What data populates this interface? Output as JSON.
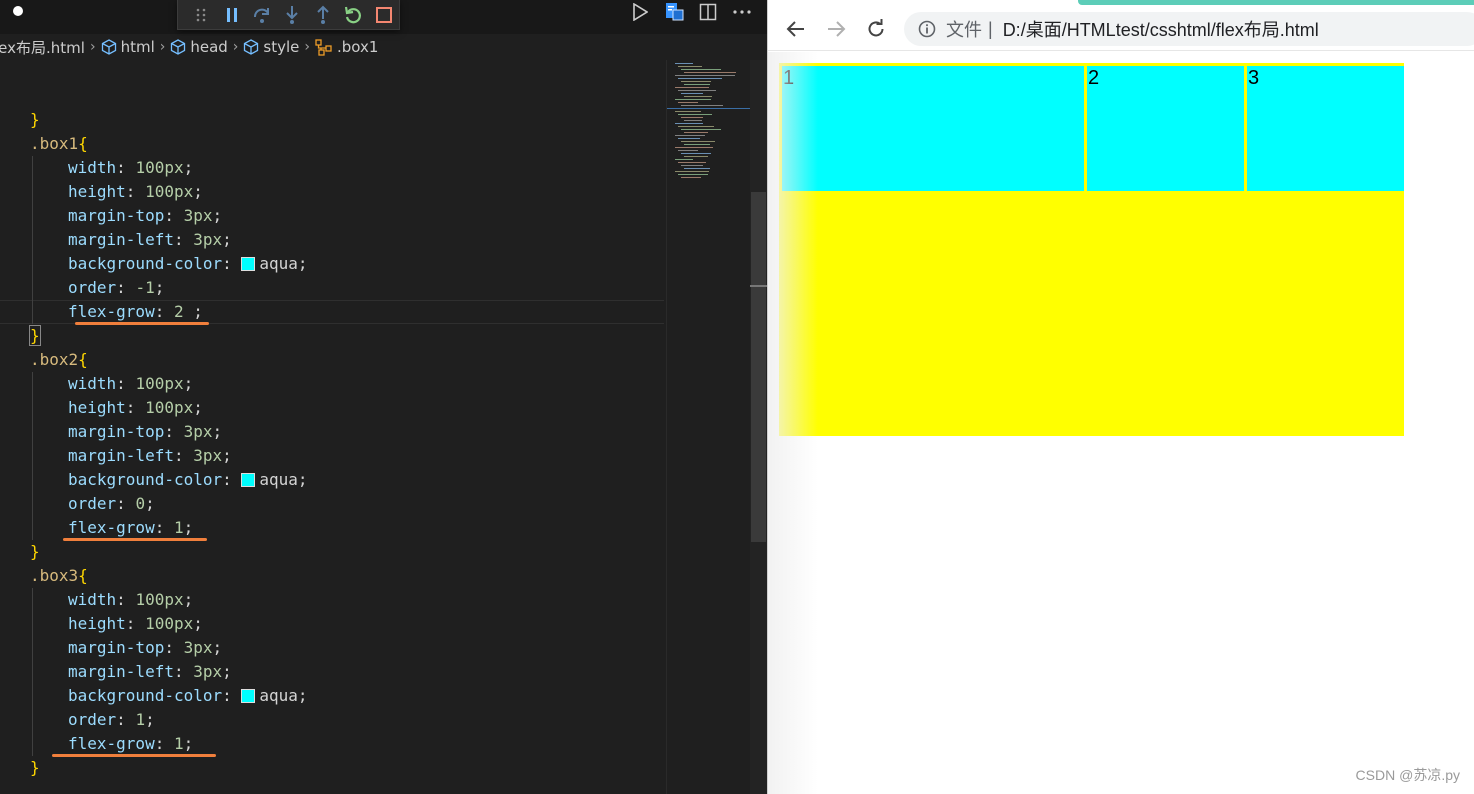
{
  "editor": {
    "breadcrumb": [
      "lex布局.html",
      "html",
      "head",
      "style",
      ".box1"
    ],
    "rules": [
      {
        "selector": ".box1",
        "decls": [
          {
            "prop": "width",
            "value": "100px"
          },
          {
            "prop": "height",
            "value": "100px"
          },
          {
            "prop": "margin-top",
            "value": "3px"
          },
          {
            "prop": "margin-left",
            "value": "3px"
          },
          {
            "prop": "background-color",
            "value": "aqua"
          },
          {
            "prop": "order",
            "value": "-1"
          },
          {
            "prop": "flex-grow",
            "value": "2 "
          }
        ]
      },
      {
        "selector": ".box2",
        "decls": [
          {
            "prop": "width",
            "value": "100px"
          },
          {
            "prop": "height",
            "value": "100px"
          },
          {
            "prop": "margin-top",
            "value": "3px"
          },
          {
            "prop": "margin-left",
            "value": "3px"
          },
          {
            "prop": "background-color",
            "value": "aqua"
          },
          {
            "prop": "order",
            "value": "0"
          },
          {
            "prop": "flex-grow",
            "value": "1"
          }
        ]
      },
      {
        "selector": ".box3",
        "decls": [
          {
            "prop": "width",
            "value": "100px"
          },
          {
            "prop": "height",
            "value": "100px"
          },
          {
            "prop": "margin-top",
            "value": "3px"
          },
          {
            "prop": "margin-left",
            "value": "3px"
          },
          {
            "prop": "background-color",
            "value": "aqua"
          },
          {
            "prop": "order",
            "value": "1"
          },
          {
            "prop": "flex-grow",
            "value": "1"
          }
        ]
      }
    ],
    "swatch_color": "#00ffff",
    "highlight_color": "#f07f3c"
  },
  "browser": {
    "url_scheme": "文件",
    "url_divider": "|",
    "url_path": "D:/桌面/HTMLtest/csshtml/flex布局.html",
    "boxes": [
      {
        "label": "1",
        "flex_grow": 2
      },
      {
        "label": "2",
        "flex_grow": 1
      },
      {
        "label": "3",
        "flex_grow": 1
      }
    ],
    "container_color": "#ffff00",
    "box_color": "#00ffff",
    "tab_accent": "#5ccdb8"
  },
  "watermark": "CSDN @苏凉.py"
}
